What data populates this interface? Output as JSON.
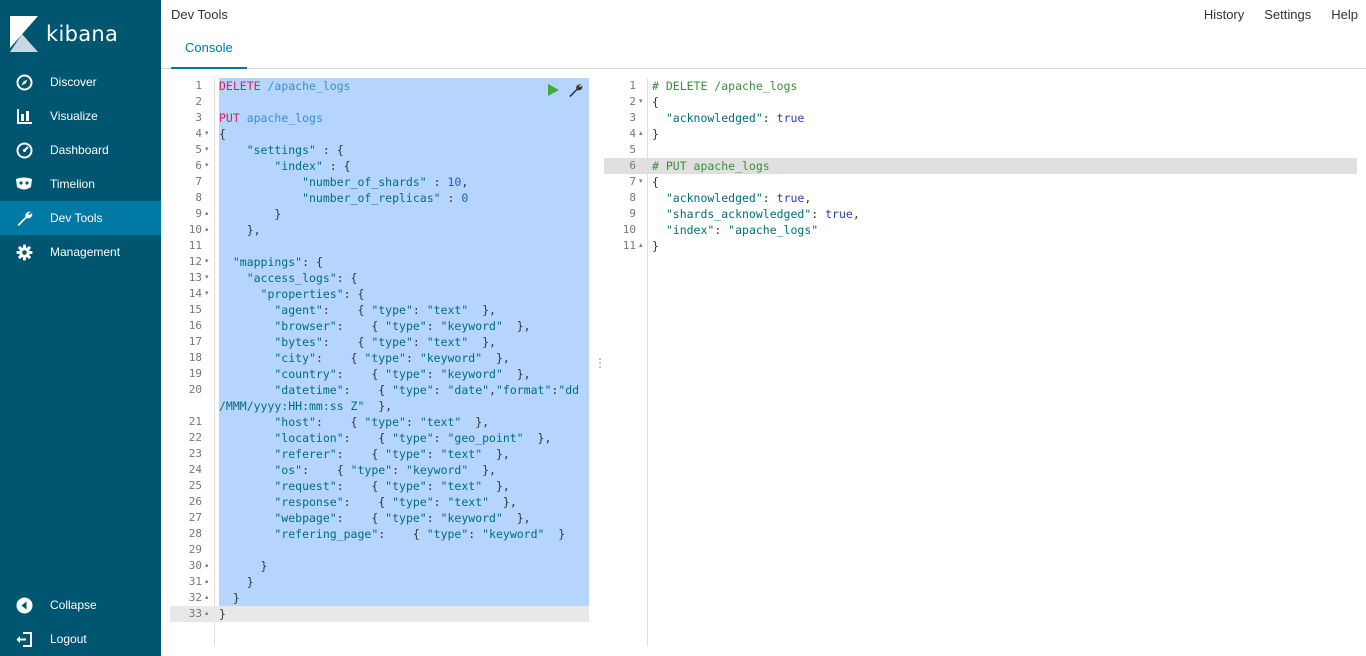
{
  "app": {
    "brand": "kibana",
    "title": "Dev Tools"
  },
  "top_links": [
    "History",
    "Settings",
    "Help"
  ],
  "tabs": [
    {
      "label": "Console",
      "active": true
    }
  ],
  "sidebar": {
    "items": [
      {
        "label": "Discover",
        "icon": "compass-icon"
      },
      {
        "label": "Visualize",
        "icon": "bar-chart-icon"
      },
      {
        "label": "Dashboard",
        "icon": "dashboard-gauge-icon"
      },
      {
        "label": "Timelion",
        "icon": "timelion-mask-icon"
      },
      {
        "label": "Dev Tools",
        "icon": "wrench-icon",
        "active": true
      },
      {
        "label": "Management",
        "icon": "gear-icon"
      }
    ],
    "footer": [
      {
        "label": "Collapse",
        "icon": "collapse-arrow-icon"
      },
      {
        "label": "Logout",
        "icon": "logout-icon"
      }
    ]
  },
  "colors": {
    "sidebar_bg": "#005571",
    "active_item": "#0079a5",
    "selection": "#b5d5ff"
  },
  "request_editor": {
    "lines": [
      [
        [
          "DELETE",
          "kw"
        ],
        [
          " /apache_logs",
          "url"
        ]
      ],
      [],
      [
        [
          "PUT",
          "kw"
        ],
        [
          " apache_logs",
          "url"
        ]
      ],
      [
        [
          "{",
          "pun"
        ]
      ],
      [
        [
          "    \"settings\"",
          "str"
        ],
        [
          " : {",
          "pun"
        ]
      ],
      [
        [
          "        \"index\"",
          "str"
        ],
        [
          " : {",
          "pun"
        ]
      ],
      [
        [
          "            \"number_of_shards\"",
          "str"
        ],
        [
          " : ",
          "pun"
        ],
        [
          "10",
          "num"
        ],
        [
          ",",
          "pun"
        ]
      ],
      [
        [
          "            \"number_of_replicas\"",
          "str"
        ],
        [
          " : ",
          "pun"
        ],
        [
          "0",
          "num"
        ]
      ],
      [
        [
          "        }",
          "pun"
        ]
      ],
      [
        [
          "    },",
          "pun"
        ]
      ],
      [],
      [
        [
          "  \"mappings\"",
          "str"
        ],
        [
          ": {",
          "pun"
        ]
      ],
      [
        [
          "    \"access_logs\"",
          "str"
        ],
        [
          ": {",
          "pun"
        ]
      ],
      [
        [
          "      \"properties\"",
          "str"
        ],
        [
          ": {",
          "pun"
        ]
      ],
      [
        [
          "        \"agent\"",
          "str"
        ],
        [
          ":    { ",
          "pun"
        ],
        [
          "\"type\"",
          "str"
        ],
        [
          ": ",
          "pun"
        ],
        [
          "\"text\"",
          "str"
        ],
        [
          "  },",
          "pun"
        ]
      ],
      [
        [
          "        \"browser\"",
          "str"
        ],
        [
          ":    { ",
          "pun"
        ],
        [
          "\"type\"",
          "str"
        ],
        [
          ": ",
          "pun"
        ],
        [
          "\"keyword\"",
          "str"
        ],
        [
          "  },",
          "pun"
        ]
      ],
      [
        [
          "        \"bytes\"",
          "str"
        ],
        [
          ":    { ",
          "pun"
        ],
        [
          "\"type\"",
          "str"
        ],
        [
          ": ",
          "pun"
        ],
        [
          "\"text\"",
          "str"
        ],
        [
          "  },",
          "pun"
        ]
      ],
      [
        [
          "        \"city\"",
          "str"
        ],
        [
          ":    { ",
          "pun"
        ],
        [
          "\"type\"",
          "str"
        ],
        [
          ": ",
          "pun"
        ],
        [
          "\"keyword\"",
          "str"
        ],
        [
          "  },",
          "pun"
        ]
      ],
      [
        [
          "        \"country\"",
          "str"
        ],
        [
          ":    { ",
          "pun"
        ],
        [
          "\"type\"",
          "str"
        ],
        [
          ": ",
          "pun"
        ],
        [
          "\"keyword\"",
          "str"
        ],
        [
          "  },",
          "pun"
        ]
      ],
      [
        [
          "        \"datetime\"",
          "str"
        ],
        [
          ":    { ",
          "pun"
        ],
        [
          "\"type\"",
          "str"
        ],
        [
          ": ",
          "pun"
        ],
        [
          "\"date\"",
          "str"
        ],
        [
          ",",
          "pun"
        ],
        [
          "\"format\"",
          "str"
        ],
        [
          ":",
          "pun"
        ],
        [
          "\"dd",
          "str"
        ]
      ],
      [
        [
          "/MMM/yyyy:HH:mm:ss Z\"",
          "str"
        ],
        [
          "  },",
          "pun"
        ]
      ],
      [
        [
          "        \"host\"",
          "str"
        ],
        [
          ":    { ",
          "pun"
        ],
        [
          "\"type\"",
          "str"
        ],
        [
          ": ",
          "pun"
        ],
        [
          "\"text\"",
          "str"
        ],
        [
          "  },",
          "pun"
        ]
      ],
      [
        [
          "        \"location\"",
          "str"
        ],
        [
          ":    { ",
          "pun"
        ],
        [
          "\"type\"",
          "str"
        ],
        [
          ": ",
          "pun"
        ],
        [
          "\"geo_point\"",
          "str"
        ],
        [
          "  },",
          "pun"
        ]
      ],
      [
        [
          "        \"referer\"",
          "str"
        ],
        [
          ":    { ",
          "pun"
        ],
        [
          "\"type\"",
          "str"
        ],
        [
          ": ",
          "pun"
        ],
        [
          "\"text\"",
          "str"
        ],
        [
          "  },",
          "pun"
        ]
      ],
      [
        [
          "        \"os\"",
          "str"
        ],
        [
          ":    { ",
          "pun"
        ],
        [
          "\"type\"",
          "str"
        ],
        [
          ": ",
          "pun"
        ],
        [
          "\"keyword\"",
          "str"
        ],
        [
          "  },",
          "pun"
        ]
      ],
      [
        [
          "        \"request\"",
          "str"
        ],
        [
          ":    { ",
          "pun"
        ],
        [
          "\"type\"",
          "str"
        ],
        [
          ": ",
          "pun"
        ],
        [
          "\"text\"",
          "str"
        ],
        [
          "  },",
          "pun"
        ]
      ],
      [
        [
          "        \"response\"",
          "str"
        ],
        [
          ":    { ",
          "pun"
        ],
        [
          "\"type\"",
          "str"
        ],
        [
          ": ",
          "pun"
        ],
        [
          "\"text\"",
          "str"
        ],
        [
          "  },",
          "pun"
        ]
      ],
      [
        [
          "        \"webpage\"",
          "str"
        ],
        [
          ":    { ",
          "pun"
        ],
        [
          "\"type\"",
          "str"
        ],
        [
          ": ",
          "pun"
        ],
        [
          "\"keyword\"",
          "str"
        ],
        [
          "  },",
          "pun"
        ]
      ],
      [
        [
          "        \"refering_page\"",
          "str"
        ],
        [
          ":    { ",
          "pun"
        ],
        [
          "\"type\"",
          "str"
        ],
        [
          ": ",
          "pun"
        ],
        [
          "\"keyword\"",
          "str"
        ],
        [
          "  }",
          "pun"
        ]
      ],
      [],
      [
        [
          "      }",
          "pun"
        ]
      ],
      [
        [
          "    }",
          "pun"
        ]
      ],
      [
        [
          "  }",
          "pun"
        ]
      ],
      [
        [
          "}",
          "pun"
        ]
      ]
    ],
    "gutter": [
      {
        "n": "1"
      },
      {
        "n": "2"
      },
      {
        "n": "3"
      },
      {
        "n": "4",
        "f": "▾"
      },
      {
        "n": "5",
        "f": "▾"
      },
      {
        "n": "6",
        "f": "▾"
      },
      {
        "n": "7"
      },
      {
        "n": "8"
      },
      {
        "n": "9",
        "f": "▴"
      },
      {
        "n": "10",
        "f": "▴"
      },
      {
        "n": "11"
      },
      {
        "n": "12",
        "f": "▾"
      },
      {
        "n": "13",
        "f": "▾"
      },
      {
        "n": "14",
        "f": "▾"
      },
      {
        "n": "15"
      },
      {
        "n": "16"
      },
      {
        "n": "17"
      },
      {
        "n": "18"
      },
      {
        "n": "19"
      },
      {
        "n": "20"
      },
      {
        "n": ""
      },
      {
        "n": "21"
      },
      {
        "n": "22"
      },
      {
        "n": "23"
      },
      {
        "n": "24"
      },
      {
        "n": "25"
      },
      {
        "n": "26"
      },
      {
        "n": "27"
      },
      {
        "n": "28"
      },
      {
        "n": "29"
      },
      {
        "n": "30",
        "f": "▴"
      },
      {
        "n": "31",
        "f": "▴"
      },
      {
        "n": "32",
        "f": "▴"
      },
      {
        "n": "33",
        "f": "▴"
      }
    ]
  },
  "response_editor": {
    "lines": [
      [
        [
          "# DELETE /apache_logs",
          "cm"
        ]
      ],
      [
        [
          "{",
          "pun"
        ]
      ],
      [
        [
          "  \"acknowledged\"",
          "str"
        ],
        [
          ": ",
          "pun"
        ],
        [
          "true",
          "bool"
        ]
      ],
      [
        [
          "}",
          "pun"
        ]
      ],
      [],
      [
        [
          "# PUT apache_logs",
          "cm"
        ]
      ],
      [
        [
          "{",
          "pun"
        ]
      ],
      [
        [
          "  \"acknowledged\"",
          "str"
        ],
        [
          ": ",
          "pun"
        ],
        [
          "true",
          "bool"
        ],
        [
          ",",
          "pun"
        ]
      ],
      [
        [
          "  \"shards_acknowledged\"",
          "str"
        ],
        [
          ": ",
          "pun"
        ],
        [
          "true",
          "bool"
        ],
        [
          ",",
          "pun"
        ]
      ],
      [
        [
          "  \"index\"",
          "str"
        ],
        [
          ": ",
          "pun"
        ],
        [
          "\"apache_logs\"",
          "str"
        ]
      ],
      [
        [
          "}",
          "pun"
        ]
      ]
    ],
    "gutter": [
      {
        "n": "1"
      },
      {
        "n": "2",
        "f": "▾"
      },
      {
        "n": "3"
      },
      {
        "n": "4",
        "f": "▴"
      },
      {
        "n": "5"
      },
      {
        "n": "6"
      },
      {
        "n": "7",
        "f": "▾"
      },
      {
        "n": "8"
      },
      {
        "n": "9"
      },
      {
        "n": "10"
      },
      {
        "n": "11",
        "f": "▴"
      }
    ]
  }
}
